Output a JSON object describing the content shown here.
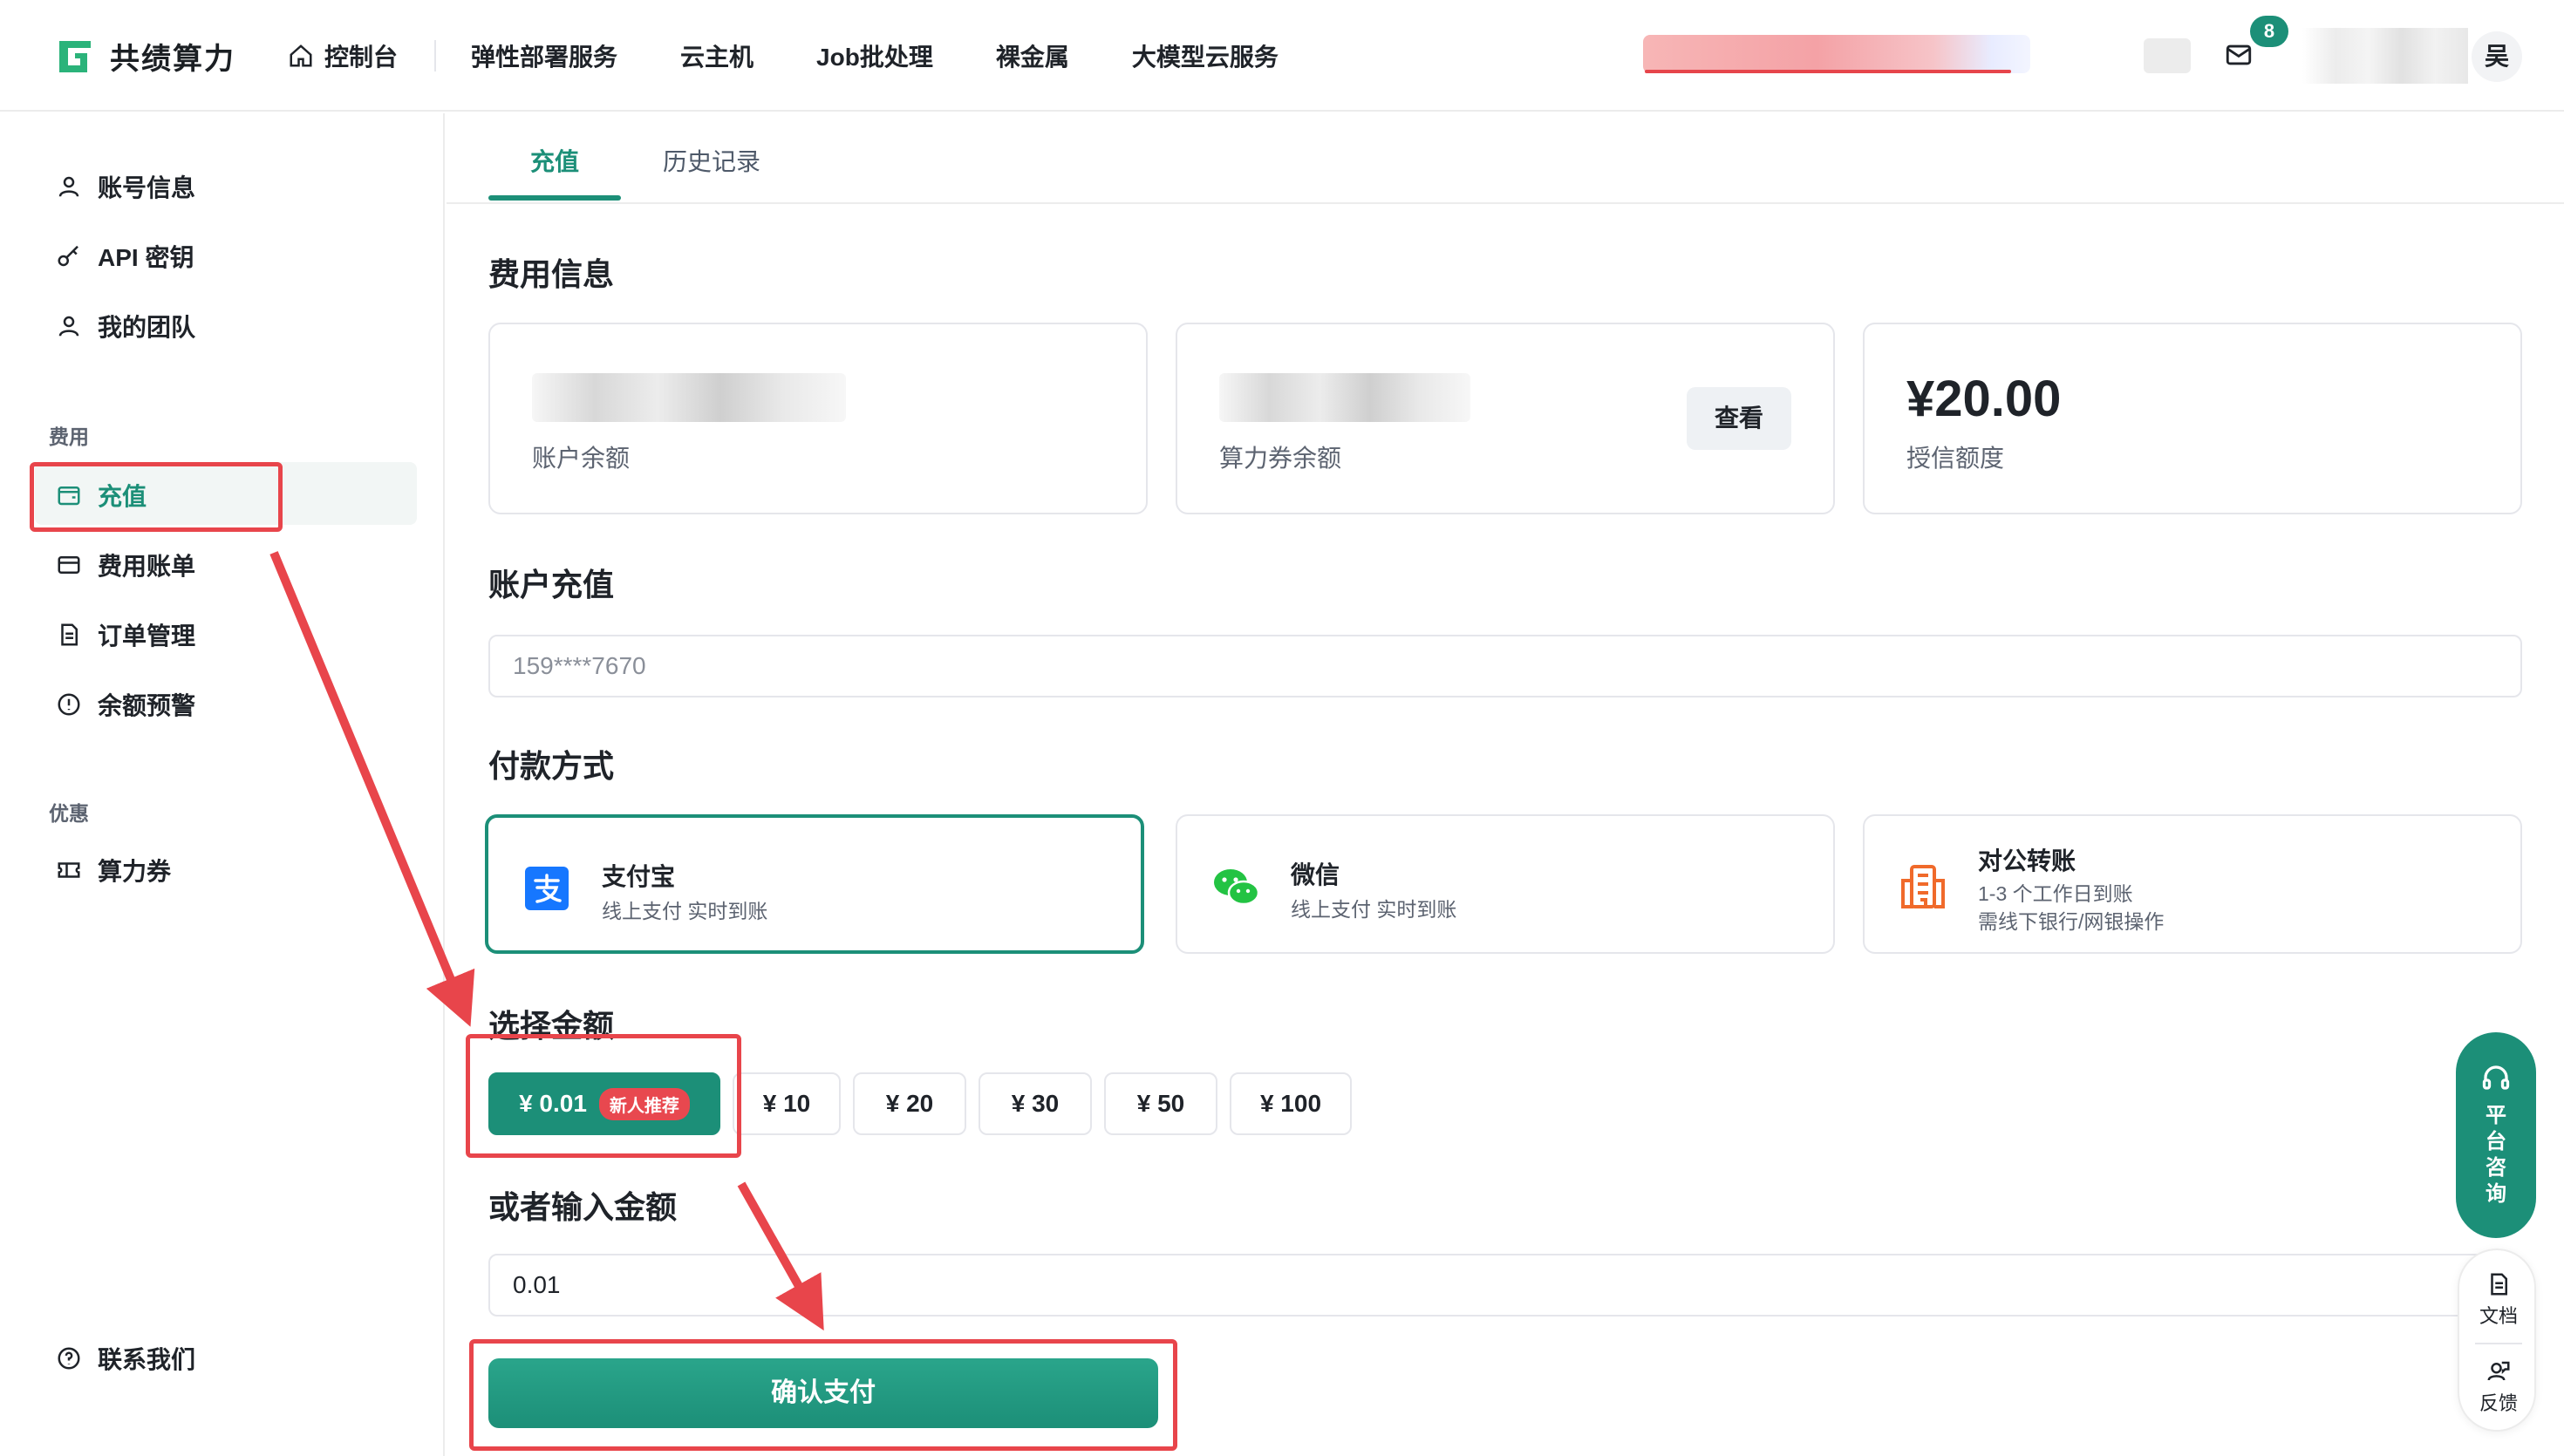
{
  "brand": {
    "name": "共绩算力",
    "color": "#1c8f78"
  },
  "nav": {
    "console": "控制台",
    "items": [
      "弹性部署服务",
      "云主机",
      "Job批处理",
      "裸金属",
      "大模型云服务"
    ],
    "notification_count": "8",
    "avatar_initial": "吴"
  },
  "sidebar": {
    "account": [
      "账号信息",
      "API 密钥",
      "我的团队"
    ],
    "billing_group": "费用",
    "billing": [
      "充值",
      "费用账单",
      "订单管理",
      "余额预警"
    ],
    "offers_group": "优惠",
    "offers": [
      "算力券"
    ],
    "contact": "联系我们"
  },
  "tabs": {
    "active": "充值",
    "history": "历史记录"
  },
  "fee_info": {
    "title": "费用信息",
    "balance_label": "账户余额",
    "voucher_label": "算力券余额",
    "view_button": "查看",
    "credit_value": "¥20.00",
    "credit_label": "授信额度"
  },
  "recharge": {
    "title": "账户充值",
    "account_value": "159****7670"
  },
  "payment": {
    "title": "付款方式",
    "methods": [
      {
        "name": "支付宝",
        "desc": "线上支付 实时到账"
      },
      {
        "name": "微信",
        "desc": "线上支付 实时到账"
      },
      {
        "name": "对公转账",
        "desc": "1-3 个工作日到账",
        "desc2": "需线下银行/网银操作"
      }
    ]
  },
  "amount": {
    "title": "选择金额",
    "options": [
      "¥ 0.01",
      "¥ 10",
      "¥ 20",
      "¥ 30",
      "¥ 50",
      "¥ 100"
    ],
    "new_tag": "新人推荐",
    "custom_title": "或者输入金额",
    "custom_value": "0.01"
  },
  "confirm_button": "确认支付",
  "floating": {
    "consult_chars": [
      "平",
      "台",
      "咨",
      "询"
    ],
    "docs": "文档",
    "feedback": "反馈"
  }
}
